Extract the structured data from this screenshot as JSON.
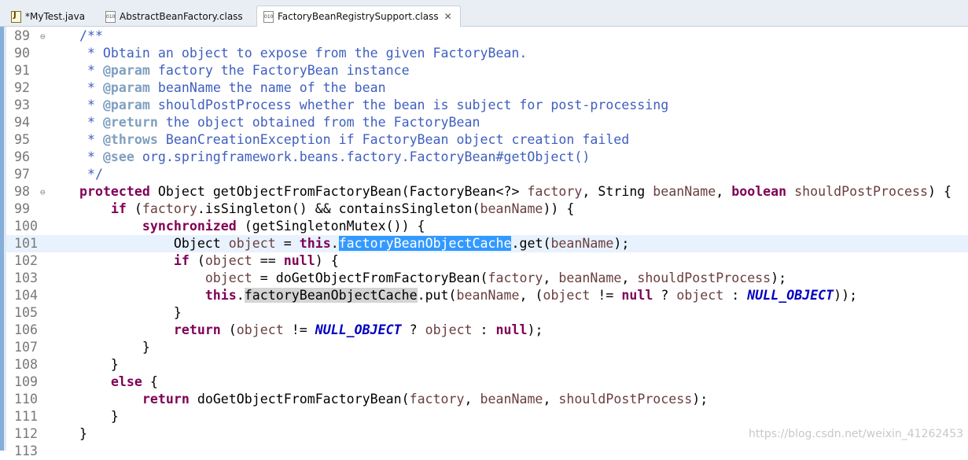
{
  "tabs": [
    {
      "label": "*MyTest.java"
    },
    {
      "label": "AbstractBeanFactory.class"
    },
    {
      "label": "FactoryBeanRegistrySupport.class"
    }
  ],
  "close_glyph": "✕",
  "fold_glyph": "⊖",
  "lines": [
    {
      "n": "89",
      "fold": true,
      "segs": [
        [
          "    ",
          ""
        ],
        [
          "/**",
          "cm"
        ]
      ]
    },
    {
      "n": "90",
      "segs": [
        [
          "     * Obtain an object to expose from the given FactoryBean.",
          "cm"
        ]
      ]
    },
    {
      "n": "91",
      "segs": [
        [
          "     * ",
          "cm"
        ],
        [
          "@param",
          "tag"
        ],
        [
          " factory the FactoryBean instance",
          "cm"
        ]
      ]
    },
    {
      "n": "92",
      "segs": [
        [
          "     * ",
          "cm"
        ],
        [
          "@param",
          "tag"
        ],
        [
          " beanName the name of the bean",
          "cm"
        ]
      ]
    },
    {
      "n": "93",
      "segs": [
        [
          "     * ",
          "cm"
        ],
        [
          "@param",
          "tag"
        ],
        [
          " shouldPostProcess whether the bean is subject for post-processing",
          "cm"
        ]
      ]
    },
    {
      "n": "94",
      "segs": [
        [
          "     * ",
          "cm"
        ],
        [
          "@return",
          "tag"
        ],
        [
          " the object obtained from the FactoryBean",
          "cm"
        ]
      ]
    },
    {
      "n": "95",
      "segs": [
        [
          "     * ",
          "cm"
        ],
        [
          "@throws",
          "tag"
        ],
        [
          " BeanCreationException if FactoryBean object creation failed",
          "cm"
        ]
      ]
    },
    {
      "n": "96",
      "segs": [
        [
          "     * ",
          "cm"
        ],
        [
          "@see",
          "tag"
        ],
        [
          " org.springframework.beans.factory.FactoryBean#getObject()",
          "cm"
        ]
      ]
    },
    {
      "n": "97",
      "segs": [
        [
          "     */",
          "cm"
        ]
      ]
    },
    {
      "n": "98",
      "fold": true,
      "segs": [
        [
          "    ",
          ""
        ],
        [
          "protected",
          "kw"
        ],
        [
          " Object getObjectFromFactoryBean(FactoryBean<?> ",
          ""
        ],
        [
          "factory",
          "pm"
        ],
        [
          ", String ",
          ""
        ],
        [
          "beanName",
          "pm"
        ],
        [
          ", ",
          ""
        ],
        [
          "boolean",
          "kw"
        ],
        [
          " ",
          ""
        ],
        [
          "shouldPostProcess",
          "pm"
        ],
        [
          ") {",
          ""
        ]
      ]
    },
    {
      "n": "99",
      "segs": [
        [
          "        ",
          ""
        ],
        [
          "if",
          "kw"
        ],
        [
          " (",
          ""
        ],
        [
          "factory",
          "pm"
        ],
        [
          ".isSingleton() && containsSingleton(",
          ""
        ],
        [
          "beanName",
          "pm"
        ],
        [
          ")) {",
          ""
        ]
      ]
    },
    {
      "n": "100",
      "segs": [
        [
          "            ",
          ""
        ],
        [
          "synchronized",
          "kw"
        ],
        [
          " (getSingletonMutex()) {",
          ""
        ]
      ]
    },
    {
      "n": "101",
      "current": true,
      "segs": [
        [
          "                Object ",
          ""
        ],
        [
          "object",
          "pm"
        ],
        [
          " = ",
          ""
        ],
        [
          "this",
          "kw"
        ],
        [
          ".",
          ""
        ],
        [
          "factoryBeanObjectCache",
          "sel"
        ],
        [
          ".get(",
          ""
        ],
        [
          "beanName",
          "pm"
        ],
        [
          ");",
          ""
        ]
      ]
    },
    {
      "n": "102",
      "segs": [
        [
          "                ",
          ""
        ],
        [
          "if",
          "kw"
        ],
        [
          " (",
          ""
        ],
        [
          "object",
          "pm"
        ],
        [
          " == ",
          ""
        ],
        [
          "null",
          "kw"
        ],
        [
          ") {",
          ""
        ]
      ]
    },
    {
      "n": "103",
      "segs": [
        [
          "                    ",
          ""
        ],
        [
          "object",
          "pm"
        ],
        [
          " = doGetObjectFromFactoryBean(",
          ""
        ],
        [
          "factory",
          "pm"
        ],
        [
          ", ",
          ""
        ],
        [
          "beanName",
          "pm"
        ],
        [
          ", ",
          ""
        ],
        [
          "shouldPostProcess",
          "pm"
        ],
        [
          ");",
          ""
        ]
      ]
    },
    {
      "n": "104",
      "segs": [
        [
          "                    ",
          ""
        ],
        [
          "this",
          "kw"
        ],
        [
          ".",
          ""
        ],
        [
          "factoryBeanObjectCache",
          "occ"
        ],
        [
          ".put(",
          ""
        ],
        [
          "beanName",
          "pm"
        ],
        [
          ", (",
          ""
        ],
        [
          "object",
          "pm"
        ],
        [
          " != ",
          ""
        ],
        [
          "null",
          "kw"
        ],
        [
          " ? ",
          ""
        ],
        [
          "object",
          "pm"
        ],
        [
          " : ",
          ""
        ],
        [
          "NULL_OBJECT",
          "cst"
        ],
        [
          "));",
          ""
        ]
      ]
    },
    {
      "n": "105",
      "segs": [
        [
          "                }",
          ""
        ]
      ]
    },
    {
      "n": "106",
      "segs": [
        [
          "                ",
          ""
        ],
        [
          "return",
          "kw"
        ],
        [
          " (",
          ""
        ],
        [
          "object",
          "pm"
        ],
        [
          " != ",
          ""
        ],
        [
          "NULL_OBJECT",
          "cst"
        ],
        [
          " ? ",
          ""
        ],
        [
          "object",
          "pm"
        ],
        [
          " : ",
          ""
        ],
        [
          "null",
          "kw"
        ],
        [
          ");",
          ""
        ]
      ]
    },
    {
      "n": "107",
      "segs": [
        [
          "            }",
          ""
        ]
      ]
    },
    {
      "n": "108",
      "segs": [
        [
          "        }",
          ""
        ]
      ]
    },
    {
      "n": "109",
      "segs": [
        [
          "        ",
          ""
        ],
        [
          "else",
          "kw"
        ],
        [
          " {",
          ""
        ]
      ]
    },
    {
      "n": "110",
      "segs": [
        [
          "            ",
          ""
        ],
        [
          "return",
          "kw"
        ],
        [
          " doGetObjectFromFactoryBean(",
          ""
        ],
        [
          "factory",
          "pm"
        ],
        [
          ", ",
          ""
        ],
        [
          "beanName",
          "pm"
        ],
        [
          ", ",
          ""
        ],
        [
          "shouldPostProcess",
          "pm"
        ],
        [
          ");",
          ""
        ]
      ]
    },
    {
      "n": "111",
      "segs": [
        [
          "        }",
          ""
        ]
      ]
    },
    {
      "n": "112",
      "segs": [
        [
          "    }",
          ""
        ]
      ]
    },
    {
      "n": "113",
      "segs": []
    }
  ],
  "watermark": "https://blog.csdn.net/weixin_41262453"
}
